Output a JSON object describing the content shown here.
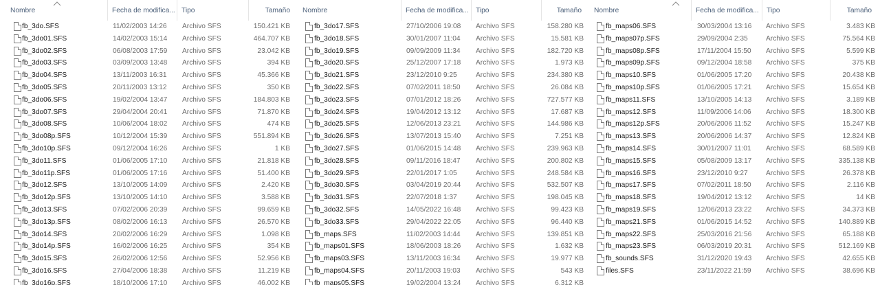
{
  "columns": {
    "name": "Nombre",
    "date": "Fecha de modifica...",
    "type": "Tipo",
    "size": "Tamaño"
  },
  "panes": [
    {
      "rows": [
        [
          "fb_3do.SFS",
          "11/02/2003 14:26",
          "Archivo SFS",
          "150.421 KB"
        ],
        [
          "fb_3do01.SFS",
          "14/02/2003 15:14",
          "Archivo SFS",
          "464.707 KB"
        ],
        [
          "fb_3do02.SFS",
          "06/08/2003 17:59",
          "Archivo SFS",
          "23.042 KB"
        ],
        [
          "fb_3do03.SFS",
          "03/09/2003 13:48",
          "Archivo SFS",
          "394 KB"
        ],
        [
          "fb_3do04.SFS",
          "13/11/2003 16:31",
          "Archivo SFS",
          "45.366 KB"
        ],
        [
          "fb_3do05.SFS",
          "20/11/2003 13:12",
          "Archivo SFS",
          "350 KB"
        ],
        [
          "fb_3do06.SFS",
          "19/02/2004 13:47",
          "Archivo SFS",
          "184.803 KB"
        ],
        [
          "fb_3do07.SFS",
          "29/04/2004 20:41",
          "Archivo SFS",
          "71.870 KB"
        ],
        [
          "fb_3do08.SFS",
          "10/06/2004 18:02",
          "Archivo SFS",
          "474 KB"
        ],
        [
          "fb_3do08p.SFS",
          "10/12/2004 15:39",
          "Archivo SFS",
          "551.894 KB"
        ],
        [
          "fb_3do10p.SFS",
          "09/12/2004 16:26",
          "Archivo SFS",
          "1 KB"
        ],
        [
          "fb_3do11.SFS",
          "01/06/2005 17:10",
          "Archivo SFS",
          "21.818 KB"
        ],
        [
          "fb_3do11p.SFS",
          "01/06/2005 17:16",
          "Archivo SFS",
          "51.400 KB"
        ],
        [
          "fb_3do12.SFS",
          "13/10/2005 14:09",
          "Archivo SFS",
          "2.420 KB"
        ],
        [
          "fb_3do12p.SFS",
          "13/10/2005 14:10",
          "Archivo SFS",
          "3.588 KB"
        ],
        [
          "fb_3do13.SFS",
          "07/02/2006 20:39",
          "Archivo SFS",
          "99.659 KB"
        ],
        [
          "fb_3do13p.SFS",
          "08/02/2006 16:13",
          "Archivo SFS",
          "26.570 KB"
        ],
        [
          "fb_3do14.SFS",
          "20/02/2006 16:29",
          "Archivo SFS",
          "1.098 KB"
        ],
        [
          "fb_3do14p.SFS",
          "16/02/2006 16:25",
          "Archivo SFS",
          "354 KB"
        ],
        [
          "fb_3do15.SFS",
          "26/02/2006 12:56",
          "Archivo SFS",
          "52.956 KB"
        ],
        [
          "fb_3do16.SFS",
          "27/04/2006 18:38",
          "Archivo SFS",
          "11.219 KB"
        ],
        [
          "fb_3do16p.SFS",
          "18/10/2006 17:10",
          "Archivo SFS",
          "46.002 KB"
        ]
      ]
    },
    {
      "rows": [
        [
          "fb_3do17.SFS",
          "27/10/2006 19:08",
          "Archivo SFS",
          "158.280 KB"
        ],
        [
          "fb_3do18.SFS",
          "30/01/2007 11:04",
          "Archivo SFS",
          "15.581 KB"
        ],
        [
          "fb_3do19.SFS",
          "09/09/2009 11:34",
          "Archivo SFS",
          "182.720 KB"
        ],
        [
          "fb_3do20.SFS",
          "25/12/2007 17:18",
          "Archivo SFS",
          "1.973 KB"
        ],
        [
          "fb_3do21.SFS",
          "23/12/2010 9:25",
          "Archivo SFS",
          "234.380 KB"
        ],
        [
          "fb_3do22.SFS",
          "07/02/2011 18:50",
          "Archivo SFS",
          "26.084 KB"
        ],
        [
          "fb_3do23.SFS",
          "07/01/2012 18:26",
          "Archivo SFS",
          "727.577 KB"
        ],
        [
          "fb_3do24.SFS",
          "19/04/2012 13:12",
          "Archivo SFS",
          "17.687 KB"
        ],
        [
          "fb_3do25.SFS",
          "12/06/2013 23:21",
          "Archivo SFS",
          "144.986 KB"
        ],
        [
          "fb_3do26.SFS",
          "13/07/2013 15:40",
          "Archivo SFS",
          "7.251 KB"
        ],
        [
          "fb_3do27.SFS",
          "01/06/2015 14:48",
          "Archivo SFS",
          "239.963 KB"
        ],
        [
          "fb_3do28.SFS",
          "09/11/2016 18:47",
          "Archivo SFS",
          "200.802 KB"
        ],
        [
          "fb_3do29.SFS",
          "22/01/2017 1:05",
          "Archivo SFS",
          "248.584 KB"
        ],
        [
          "fb_3do30.SFS",
          "03/04/2019 20:44",
          "Archivo SFS",
          "532.507 KB"
        ],
        [
          "fb_3do31.SFS",
          "22/07/2018 1:37",
          "Archivo SFS",
          "198.045 KB"
        ],
        [
          "fb_3do32.SFS",
          "14/05/2022 16:48",
          "Archivo SFS",
          "99.423 KB"
        ],
        [
          "fb_3do33.SFS",
          "29/04/2022 22:05",
          "Archivo SFS",
          "96.440 KB"
        ],
        [
          "fb_maps.SFS",
          "11/02/2003 14:44",
          "Archivo SFS",
          "139.851 KB"
        ],
        [
          "fb_maps01.SFS",
          "18/06/2003 18:26",
          "Archivo SFS",
          "1.632 KB"
        ],
        [
          "fb_maps03.SFS",
          "13/11/2003 16:34",
          "Archivo SFS",
          "19.977 KB"
        ],
        [
          "fb_maps04.SFS",
          "20/11/2003 19:03",
          "Archivo SFS",
          "543 KB"
        ],
        [
          "fb_maps05.SFS",
          "19/02/2004 13:24",
          "Archivo SFS",
          "6.312 KB"
        ]
      ]
    },
    {
      "rows": [
        [
          "fb_maps06.SFS",
          "30/03/2004 13:16",
          "Archivo SFS",
          "3.483 KB"
        ],
        [
          "fb_maps07p.SFS",
          "29/09/2004 2:35",
          "Archivo SFS",
          "75.564 KB"
        ],
        [
          "fb_maps08p.SFS",
          "17/11/2004 15:50",
          "Archivo SFS",
          "5.599 KB"
        ],
        [
          "fb_maps09p.SFS",
          "09/12/2004 18:58",
          "Archivo SFS",
          "375 KB"
        ],
        [
          "fb_maps10.SFS",
          "01/06/2005 17:20",
          "Archivo SFS",
          "20.438 KB"
        ],
        [
          "fb_maps10p.SFS",
          "01/06/2005 17:21",
          "Archivo SFS",
          "15.654 KB"
        ],
        [
          "fb_maps11.SFS",
          "13/10/2005 14:13",
          "Archivo SFS",
          "3.189 KB"
        ],
        [
          "fb_maps12.SFS",
          "11/09/2006 14:06",
          "Archivo SFS",
          "18.300 KB"
        ],
        [
          "fb_maps12p.SFS",
          "20/06/2006 11:52",
          "Archivo SFS",
          "15.247 KB"
        ],
        [
          "fb_maps13.SFS",
          "20/06/2006 14:37",
          "Archivo SFS",
          "12.824 KB"
        ],
        [
          "fb_maps14.SFS",
          "30/01/2007 11:01",
          "Archivo SFS",
          "68.589 KB"
        ],
        [
          "fb_maps15.SFS",
          "05/08/2009 13:17",
          "Archivo SFS",
          "335.138 KB"
        ],
        [
          "fb_maps16.SFS",
          "23/12/2010 9:27",
          "Archivo SFS",
          "26.378 KB"
        ],
        [
          "fb_maps17.SFS",
          "07/02/2011 18:50",
          "Archivo SFS",
          "2.116 KB"
        ],
        [
          "fb_maps18.SFS",
          "19/04/2012 13:12",
          "Archivo SFS",
          "14 KB"
        ],
        [
          "fb_maps19.SFS",
          "12/06/2013 23:22",
          "Archivo SFS",
          "34.373 KB"
        ],
        [
          "fb_maps21.SFS",
          "01/06/2015 14:52",
          "Archivo SFS",
          "140.889 KB"
        ],
        [
          "fb_maps22.SFS",
          "25/03/2016 21:56",
          "Archivo SFS",
          "65.188 KB"
        ],
        [
          "fb_maps23.SFS",
          "06/03/2019 20:31",
          "Archivo SFS",
          "512.169 KB"
        ],
        [
          "fb_sounds.SFS",
          "31/12/2020 19:43",
          "Archivo SFS",
          "42.655 KB"
        ],
        [
          "files.SFS",
          "23/11/2022 21:59",
          "Archivo SFS",
          "38.696 KB"
        ]
      ]
    }
  ]
}
